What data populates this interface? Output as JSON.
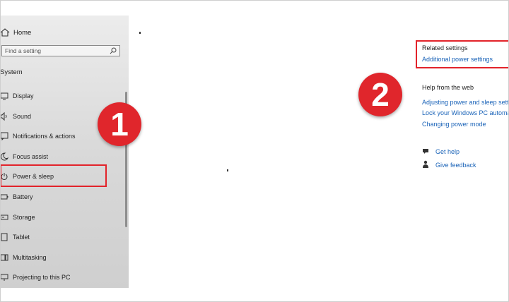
{
  "sidebar": {
    "home_label": "Home",
    "search_placeholder": "Find a setting",
    "group_label": "System",
    "items": [
      {
        "label": "Display",
        "icon": "monitor-icon"
      },
      {
        "label": "Sound",
        "icon": "speaker-icon"
      },
      {
        "label": "Notifications & actions",
        "icon": "notification-icon"
      },
      {
        "label": "Focus assist",
        "icon": "moon-icon"
      },
      {
        "label": "Power & sleep",
        "icon": "power-icon"
      },
      {
        "label": "Battery",
        "icon": "battery-icon"
      },
      {
        "label": "Storage",
        "icon": "storage-icon"
      },
      {
        "label": "Tablet",
        "icon": "tablet-icon"
      },
      {
        "label": "Multitasking",
        "icon": "multitasking-icon"
      },
      {
        "label": "Projecting to this PC",
        "icon": "projector-icon"
      }
    ]
  },
  "badges": {
    "one": "1",
    "two": "2"
  },
  "right": {
    "related_heading": "Related settings",
    "related_link": "Additional power settings",
    "help_heading": "Help from the web",
    "help_links": [
      "Adjusting power and sleep settings",
      "Lock your Windows PC automatically",
      "Changing power mode"
    ],
    "get_help": "Get help",
    "give_feedback": "Give feedback"
  },
  "colors": {
    "accent_red": "#e0262c",
    "link_blue": "#1a63b8"
  }
}
